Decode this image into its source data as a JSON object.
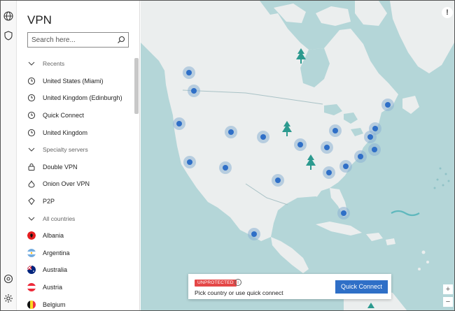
{
  "app": {
    "title": "VPN"
  },
  "rail": {
    "icons": [
      "globe-icon",
      "shield-icon",
      "help-icon",
      "settings-icon"
    ]
  },
  "search": {
    "placeholder": "Search here..."
  },
  "list": {
    "recents_label": "Recents",
    "recents": [
      "United States (Miami)",
      "United Kingdom (Edinburgh)",
      "Quick Connect",
      "United Kingdom"
    ],
    "specialty_label": "Specialty servers",
    "specialty": [
      "Double VPN",
      "Onion Over VPN",
      "P2P"
    ],
    "countries_label": "All countries",
    "countries": [
      "Albania",
      "Argentina",
      "Australia",
      "Austria",
      "Belgium"
    ]
  },
  "status": {
    "badge": "UNPROTECTED",
    "info": "i",
    "message": "Pick country or use quick connect",
    "button": "Quick Connect"
  },
  "map": {
    "alert": "!",
    "zoom_in": "+",
    "zoom_out": "−"
  },
  "colors": {
    "ocean": "#b4d6d8",
    "land": "#ebeeee",
    "accent": "#2f6fc7",
    "danger": "#e44747",
    "tree": "#2c9a8f"
  }
}
